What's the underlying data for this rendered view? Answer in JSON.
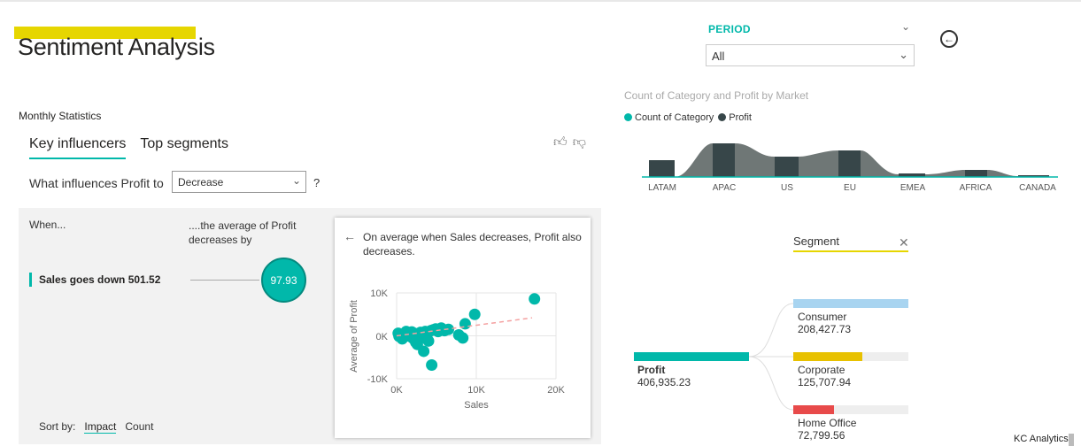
{
  "header": {
    "title": "Sentiment Analysis"
  },
  "section": {
    "label": "Monthly Statistics"
  },
  "key_influencers": {
    "tabs": [
      {
        "label": "Key influencers",
        "active": true
      },
      {
        "label": "Top segments",
        "active": false
      }
    ],
    "question_prefix": "What influences Profit to",
    "dropdown_value": "Decrease",
    "help": "?",
    "when_label": "When...",
    "avg_label": "....the average of Profit decreases by",
    "influencer": {
      "label": "Sales goes down 501.52",
      "value": "97.93"
    },
    "sort_by": {
      "label": "Sort by:",
      "options": [
        "Impact",
        "Count"
      ],
      "active": "Impact"
    },
    "card": {
      "text": "On average when Sales decreases, Profit also decreases.",
      "scatter": {
        "type": "scatter",
        "xlabel": "Sales",
        "ylabel": "Average of Profit",
        "x_ticks": [
          "0K",
          "10K",
          "20K"
        ],
        "y_ticks": [
          "10K",
          "0K",
          "-10K"
        ],
        "xlim": [
          0,
          20000
        ],
        "ylim": [
          -10000,
          10000
        ]
      }
    }
  },
  "filter": {
    "label": "PERIOD",
    "value": "All"
  },
  "ribbon": {
    "title": "Count of Category and Profit by Market",
    "legend": [
      {
        "name": "Count of Category",
        "color": "#01b8aa"
      },
      {
        "name": "Profit",
        "color": "#374649"
      }
    ],
    "markets": [
      "LATAM",
      "APAC",
      "US",
      "EU",
      "EMEA",
      "AFRICA",
      "CANADA"
    ]
  },
  "decomposition": {
    "header": "Segment",
    "root": {
      "label": "Profit",
      "value": "406,935.23"
    },
    "nodes": [
      {
        "label": "Consumer",
        "value": "208,427.73",
        "fraction": 1.0,
        "color": "#a8d4f0"
      },
      {
        "label": "Corporate",
        "value": "125,707.94",
        "fraction": 0.6,
        "color": "#e8c100"
      },
      {
        "label": "Home Office",
        "value": "72,799.56",
        "fraction": 0.35,
        "color": "#e84a4a"
      }
    ]
  },
  "footer": {
    "brand": "KC Analytics"
  },
  "chart_data": {
    "type": "scatter",
    "title": "",
    "xlabel": "Sales",
    "ylabel": "Average of Profit",
    "xlim": [
      0,
      20000
    ],
    "ylim": [
      -10000,
      10000
    ],
    "points": [
      [
        300,
        -100
      ],
      [
        600,
        200
      ],
      [
        900,
        -300
      ],
      [
        1100,
        300
      ],
      [
        1400,
        0
      ],
      [
        1700,
        400
      ],
      [
        2000,
        -500
      ],
      [
        2200,
        600
      ],
      [
        2500,
        300
      ],
      [
        2800,
        -800
      ],
      [
        3000,
        800
      ],
      [
        3300,
        600
      ],
      [
        3600,
        1000
      ],
      [
        3800,
        200
      ],
      [
        4000,
        -1200
      ],
      [
        4300,
        1200
      ],
      [
        4600,
        1400
      ],
      [
        4900,
        1600
      ],
      [
        5200,
        1000
      ],
      [
        5600,
        1800
      ],
      [
        6000,
        1200
      ],
      [
        6500,
        1500
      ],
      [
        2600,
        -2000
      ],
      [
        3400,
        -3600
      ],
      [
        4400,
        -6800
      ],
      [
        7800,
        200
      ],
      [
        8600,
        2800
      ],
      [
        9800,
        5000
      ],
      [
        8300,
        -500
      ],
      [
        17300,
        8600
      ],
      [
        200,
        600
      ],
      [
        700,
        -700
      ],
      [
        1200,
        1000
      ],
      [
        1900,
        900
      ],
      [
        2400,
        -1500
      ]
    ],
    "trend": {
      "from": [
        0,
        0
      ],
      "to": [
        17000,
        4200
      ]
    }
  }
}
